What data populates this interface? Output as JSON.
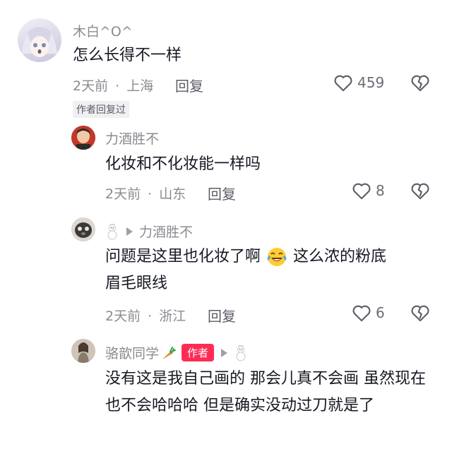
{
  "comments": [
    {
      "username": "木白^O^",
      "text": "怎么长得不一样",
      "time": "2天前",
      "location": "上海",
      "reply_label": "回复",
      "likes": "459",
      "tag": "作者回复过"
    },
    {
      "username": "力酒胜不",
      "text": "化妆和不化妆能一样吗",
      "time": "2天前",
      "location": "山东",
      "reply_label": "回复",
      "likes": "8"
    },
    {
      "reply_to": "力酒胜不",
      "text_line1_a": "问题是这里也化妆了啊",
      "text_line1_b": "这么浓的粉底",
      "text_line2": "眉毛眼线",
      "time": "2天前",
      "location": "浙江",
      "reply_label": "回复",
      "likes": "6"
    },
    {
      "username": "骆歆同学",
      "author_tag": "作者",
      "text": "没有这是我自己画的 那会儿真不会画 虽然现在也不会哈哈哈 但是确实没动过刀就是了"
    }
  ],
  "separator": "·",
  "icons": [
    "heart-outline-icon",
    "broken-heart-icon",
    "play-arrow-icon",
    "snowman-icon",
    "carrot-icon",
    "laughing-crying-emoji-icon"
  ]
}
